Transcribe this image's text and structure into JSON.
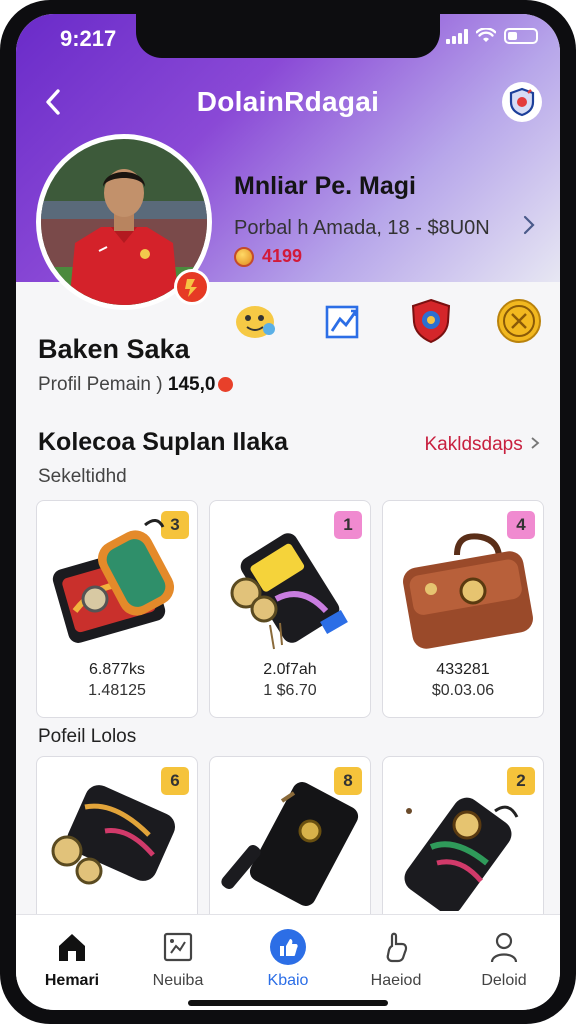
{
  "status_bar": {
    "time": "9:217"
  },
  "header": {
    "title": "DolainRdagai"
  },
  "hero": {
    "name": "Mnliar Pe. Magi",
    "subtitle": "Porbal h Amada, 18 - $8U0N",
    "coins": "4199"
  },
  "profile": {
    "name": "Baken Saka",
    "subtitle_prefix": "Profil Pemain )",
    "subtitle_value": "145,0"
  },
  "collection": {
    "title": "Kolecoa Suplan Ilaka",
    "link": "Kakldsdaps",
    "subtitle": "Sekeltidhd",
    "items": [
      {
        "badge": "3",
        "title": "6.877ks",
        "price": "1.48125"
      },
      {
        "badge": "1",
        "title": "2.0f7ah",
        "price": "1 $6.70"
      },
      {
        "badge": "4",
        "title": "433281",
        "price": "$0.03.06"
      }
    ]
  },
  "second_row": {
    "label": "Pofeil  Lolos",
    "items": [
      {
        "badge": "6"
      },
      {
        "badge": "8"
      },
      {
        "badge": "2"
      }
    ]
  },
  "tabbar": {
    "items": [
      {
        "label": "Hemari",
        "icon": "home-icon"
      },
      {
        "label": "Neuiba",
        "icon": "grid-icon"
      },
      {
        "label": "Kbaio",
        "icon": "thumbs-up-icon"
      },
      {
        "label": "Haeiod",
        "icon": "hand-icon"
      },
      {
        "label": "Deloid",
        "icon": "profile-icon"
      }
    ]
  },
  "colors": {
    "accent_purple": "#6a2bc9",
    "tab_active": "#2c6ee6",
    "price_red": "#d21a3a",
    "link_red": "#c8203f"
  }
}
